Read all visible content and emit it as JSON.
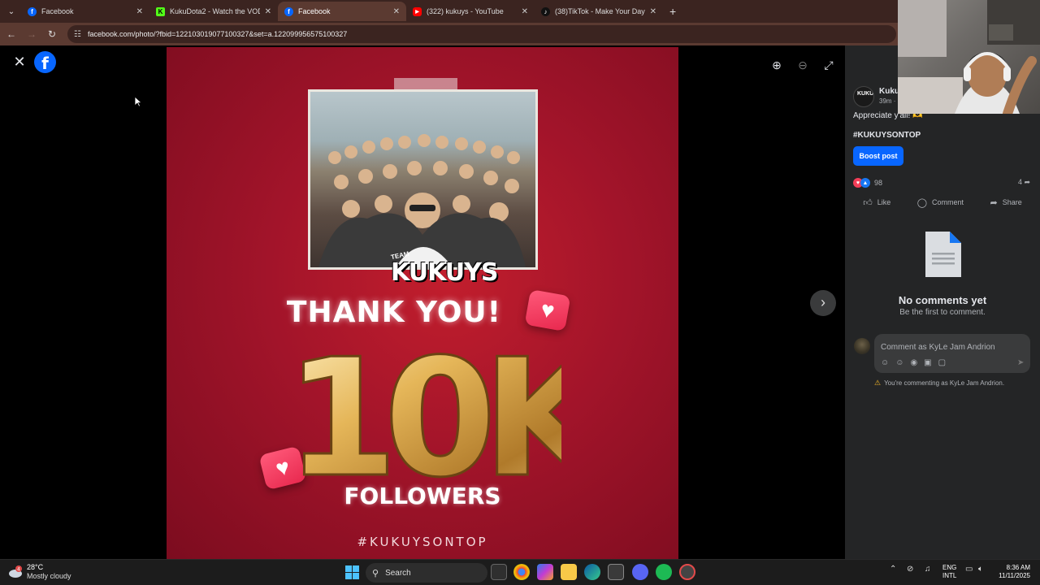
{
  "browser": {
    "tabs": [
      {
        "title": "Facebook",
        "favicon": "facebook-icon",
        "active": false,
        "color": "#0866ff"
      },
      {
        "title": "KukuDota2 - Watch the VOD on",
        "favicon": "kick-icon",
        "active": false,
        "color": "#53fc18"
      },
      {
        "title": "Facebook",
        "favicon": "facebook-icon",
        "active": true,
        "color": "#0866ff"
      },
      {
        "title": "(322) kukuys - YouTube",
        "favicon": "youtube-icon",
        "active": false,
        "color": "#ff0000"
      },
      {
        "title": "(38)TikTok - Make Your Day",
        "favicon": "tiktok-icon",
        "active": false,
        "color": "#000000"
      }
    ],
    "url": "facebook.com/photo/?fbid=122103019077100327&set=a.122099956575100327"
  },
  "photo": {
    "team_small": "TEAM",
    "team_name": "KUKUYS",
    "thank_you": "THANK YOU!",
    "milestone": "10K",
    "followers": "FOLLOWERS",
    "hashtag": "#KUKUYSONTOP"
  },
  "post": {
    "page_name": "Kukuy",
    "time": "39m ·",
    "caption": "Appreciate y'all! 🫶",
    "hashtag": "#KUKUYSONTOP",
    "boost_label": "Boost post",
    "reactions_count": "98",
    "shares_count": "4",
    "like_label": "Like",
    "comment_label": "Comment",
    "share_label": "Share",
    "no_comments_title": "No comments yet",
    "no_comments_sub": "Be the first to comment.",
    "comment_placeholder": "Comment as KyLe Jam Andrion",
    "commenting_as": "You're commenting as KyLe Jam Andrion."
  },
  "taskbar": {
    "temperature": "28°C",
    "weather": "Mostly cloudy",
    "weather_badge": "4",
    "search_label": "Search",
    "lang_top": "ENG",
    "lang_bottom": "INTL",
    "time": "8:36 AM",
    "date": "11/11/2025"
  },
  "colors": {
    "facebook_blue": "#0866ff",
    "panel_bg": "#242526",
    "photo_red": "#a2142a"
  }
}
